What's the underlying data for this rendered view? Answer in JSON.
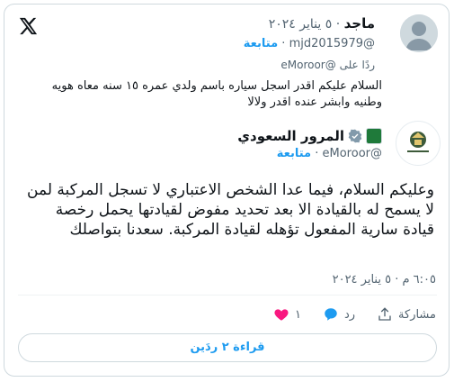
{
  "reply": {
    "name": "ماجد",
    "dot": "·",
    "date": "٥ يناير ٢٠٢٤",
    "handle": "@mjd2015979",
    "follow_label": "متابعة",
    "replying_to": "ردًا على @eMoroor",
    "text": "السلام عليكم اقدر اسجل سياره باسم ولدي عمره ١٥ سنه معاه هويه وطنيه وابشر عنده اقدر ولالا"
  },
  "org": {
    "name": "المرور السعودي",
    "handle": "@eMoroor",
    "follow_label": "متابعة",
    "logo_caption": "المرور السعودي"
  },
  "main_tweet": {
    "text": "وعليكم السلام، فيما عدا الشخص الاعتباري لا تسجل المركبة لمن لا يسمح له بالقيادة الا بعد تحديد مفوض لقيادتها يحمل رخصة قيادة سارية المفعول تؤهله لقيادة المركبة. سعدنا بتواصلك",
    "timestamp": "٦:٠٥ م · ٥ يناير ٢٠٢٤"
  },
  "actions": {
    "likes": "١",
    "reply_label": "رد",
    "share_label": "مشاركة"
  },
  "read_replies": "قراءة ٢ ردَين",
  "colors": {
    "accent": "#1d9bf0",
    "like": "#f91880",
    "muted": "#536471",
    "verified": "#829aab"
  }
}
